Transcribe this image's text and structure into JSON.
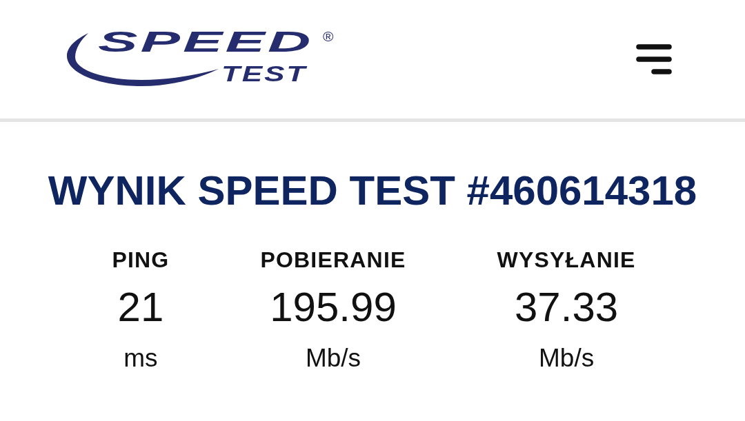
{
  "header": {
    "logo": {
      "wordmark": "SPEED",
      "subtitle": "TEST",
      "registered": "®"
    }
  },
  "title": "WYNIK SPEED TEST #460614318",
  "results": [
    {
      "label": "PING",
      "value": "21",
      "unit": "ms"
    },
    {
      "label": "POBIERANIE",
      "value": "195.99",
      "unit": "Mb/s"
    },
    {
      "label": "WYSYŁANIE",
      "value": "37.33",
      "unit": "Mb/s"
    }
  ]
}
